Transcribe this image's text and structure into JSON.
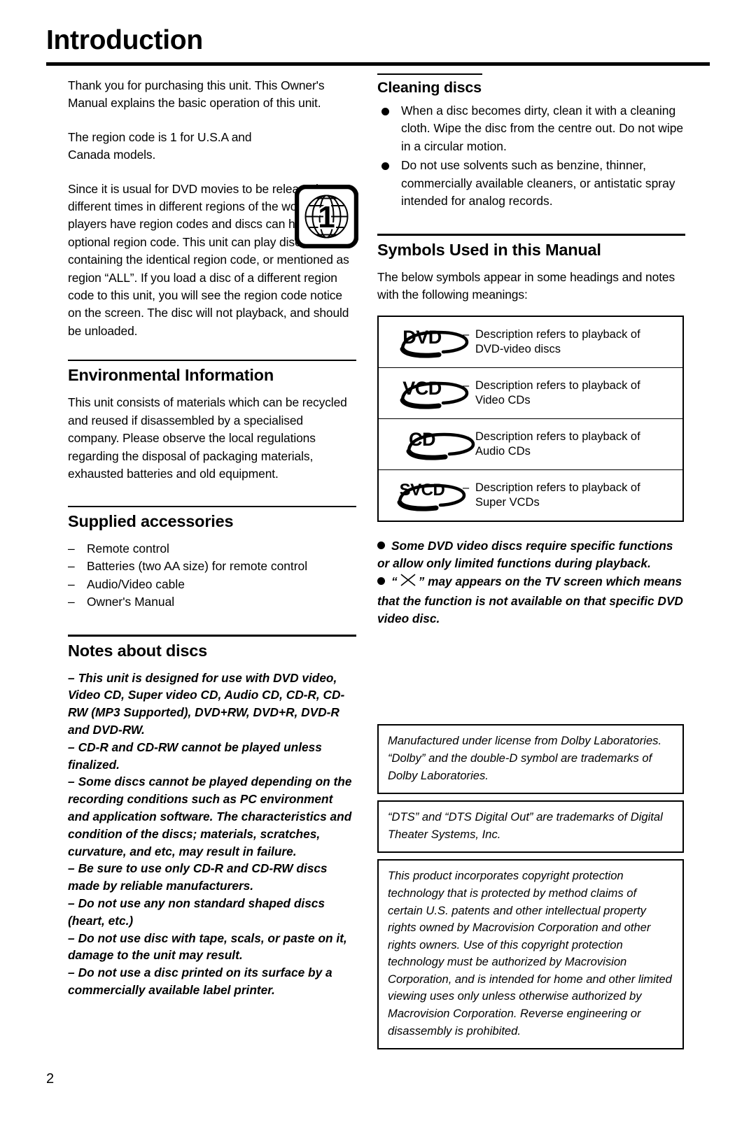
{
  "page": {
    "title": "Introduction",
    "number": "2"
  },
  "left": {
    "intro": "Thank you for purchasing this unit. This Owner's Manual explains the basic operation of this unit.",
    "region_code_note": "The region code is 1 for U.S.A and Canada models.",
    "region_icon_label": "1",
    "region_explanation": "Since it is usual for DVD movies to be released at different times in different regions of the world, all players have region codes and discs can have an optional region code. This unit can play discs containing the identical region code, or mentioned as region “ALL”. If you load a disc of a different region code to this unit, you will see the region code notice on the screen. The disc will not playback, and should be unloaded.",
    "environmental": {
      "heading": "Environmental Information",
      "body": "This unit consists of materials which can be recycled and reused if disassembled by a specialised company. Please observe the local regulations regarding the disposal of packaging materials, exhausted batteries and old equipment."
    },
    "supplied": {
      "heading": "Supplied accessories",
      "dash": "–",
      "items": [
        "Remote control",
        "Batteries (two AA size) for remote control",
        "Audio/Video cable",
        "Owner's Manual"
      ]
    },
    "notes_about_discs": {
      "heading": "Notes about discs",
      "dash": "–",
      "items": [
        "This unit is designed for use with DVD video, Video CD, Super video CD, Audio CD, CD-R, CD-RW (MP3 Supported), DVD+RW, DVD+R, DVD-R and DVD-RW.",
        "CD-R and CD-RW cannot be played unless finalized.",
        "Some discs cannot be played depending on the recording conditions such as PC environment and application software.  The characteristics and condition of the discs; materials, scratches, curvature, and etc, may result in failure.",
        "Be sure to use only CD-R and CD-RW discs made by reliable manufacturers.",
        "Do not use any non standard shaped discs (heart, etc.)",
        "Do not use disc with tape, scals, or paste on it, damage to the unit may result.",
        "Do not use a disc printed on its surface by a commercially available label printer."
      ]
    }
  },
  "right": {
    "cleaning": {
      "heading": "Cleaning discs",
      "bullets": [
        "When a disc becomes dirty, clean it with a cleaning cloth. Wipe the disc from the centre out. Do not wipe in a circular motion.",
        "Do not use solvents such as benzine, thinner, commercially available cleaners, or antistatic spray intended for analog records."
      ]
    },
    "symbols": {
      "heading": "Symbols Used in this Manual",
      "intro": "The below symbols appear in some headings and notes with the following meanings:",
      "dash": "–",
      "rows": [
        {
          "logo": "DVD",
          "desc_line1": "Description refers to playback of",
          "desc_line2": "DVD-video discs"
        },
        {
          "logo": "VCD",
          "desc_line1": "Description refers to playback of",
          "desc_line2": "Video CDs"
        },
        {
          "logo": "CD",
          "desc_line1": "Description refers to playback of",
          "desc_line2": "Audio CDs"
        },
        {
          "logo": "SVCD",
          "desc_line1": "Description refers to playback of",
          "desc_line2": "Super VCDs"
        }
      ],
      "note1": "Some DVD video discs require specific functions or allow only limited functions during playback.",
      "note2_prefix": "“",
      "note2_suffix": "” may appears on the TV screen which means that the function is not available on that specific DVD video disc."
    },
    "legal": [
      "Manufactured under license from Dolby Laboratories. “Dolby” and the double-D symbol are trademarks of Dolby Laboratories.",
      "“DTS” and “DTS Digital Out” are trademarks of Digital Theater Systems, Inc.",
      "This product incorporates copyright protection technology that is protected by method claims of certain U.S. patents and other intellectual property rights owned by Macrovision Corporation and other rights owners. Use of this copyright protection technology must be authorized by Macrovision Corporation, and is intended for home and other limited viewing uses only unless otherwise authorized by Macrovision Corporation. Reverse engineering or disassembly is prohibited."
    ]
  }
}
